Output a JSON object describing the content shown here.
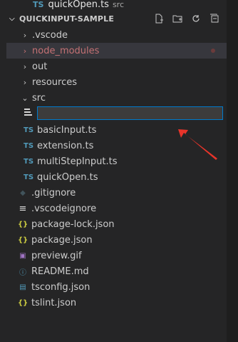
{
  "open_editor": {
    "badge": "TS",
    "name": "quickOpen.ts",
    "description": "src"
  },
  "explorer": {
    "title": "QUICKINPUT-SAMPLE",
    "actions": [
      "new-file-icon",
      "new-folder-icon",
      "refresh-icon",
      "collapse-all-icon"
    ],
    "folders": [
      {
        "label": ".vscode"
      },
      {
        "label": "node_modules"
      },
      {
        "label": "out"
      },
      {
        "label": "resources"
      },
      {
        "label": "src"
      }
    ],
    "new_file_input": {
      "value": "",
      "placeholder": ""
    },
    "src_files": [
      {
        "badge": "TS",
        "label": "basicInput.ts"
      },
      {
        "badge": "TS",
        "label": "extension.ts"
      },
      {
        "badge": "TS",
        "label": "multiStepInput.ts"
      },
      {
        "badge": "TS",
        "label": "quickOpen.ts"
      }
    ],
    "root_files": [
      {
        "icon": "git-icon",
        "glyph": "◆",
        "label": ".gitignore"
      },
      {
        "icon": "lines-icon",
        "glyph": "≡",
        "label": ".vscodeignore"
      },
      {
        "icon": "json-icon",
        "glyph": "{}",
        "label": "package-lock.json"
      },
      {
        "icon": "json-icon",
        "glyph": "{}",
        "label": "package.json"
      },
      {
        "icon": "image-icon",
        "glyph": "▣",
        "label": "preview.gif"
      },
      {
        "icon": "info-icon",
        "glyph": "ⓘ",
        "label": "README.md"
      },
      {
        "icon": "tsconfig-icon",
        "glyph": "▤",
        "label": "tsconfig.json"
      },
      {
        "icon": "json-icon",
        "glyph": "{}",
        "label": "tslint.json"
      }
    ]
  },
  "colors": {
    "ts_badge": "#519aba",
    "node_modules_text": "#c47174",
    "json_icon": "#cbcb41",
    "arrow": "#e8342a",
    "input_border": "#007acc"
  }
}
